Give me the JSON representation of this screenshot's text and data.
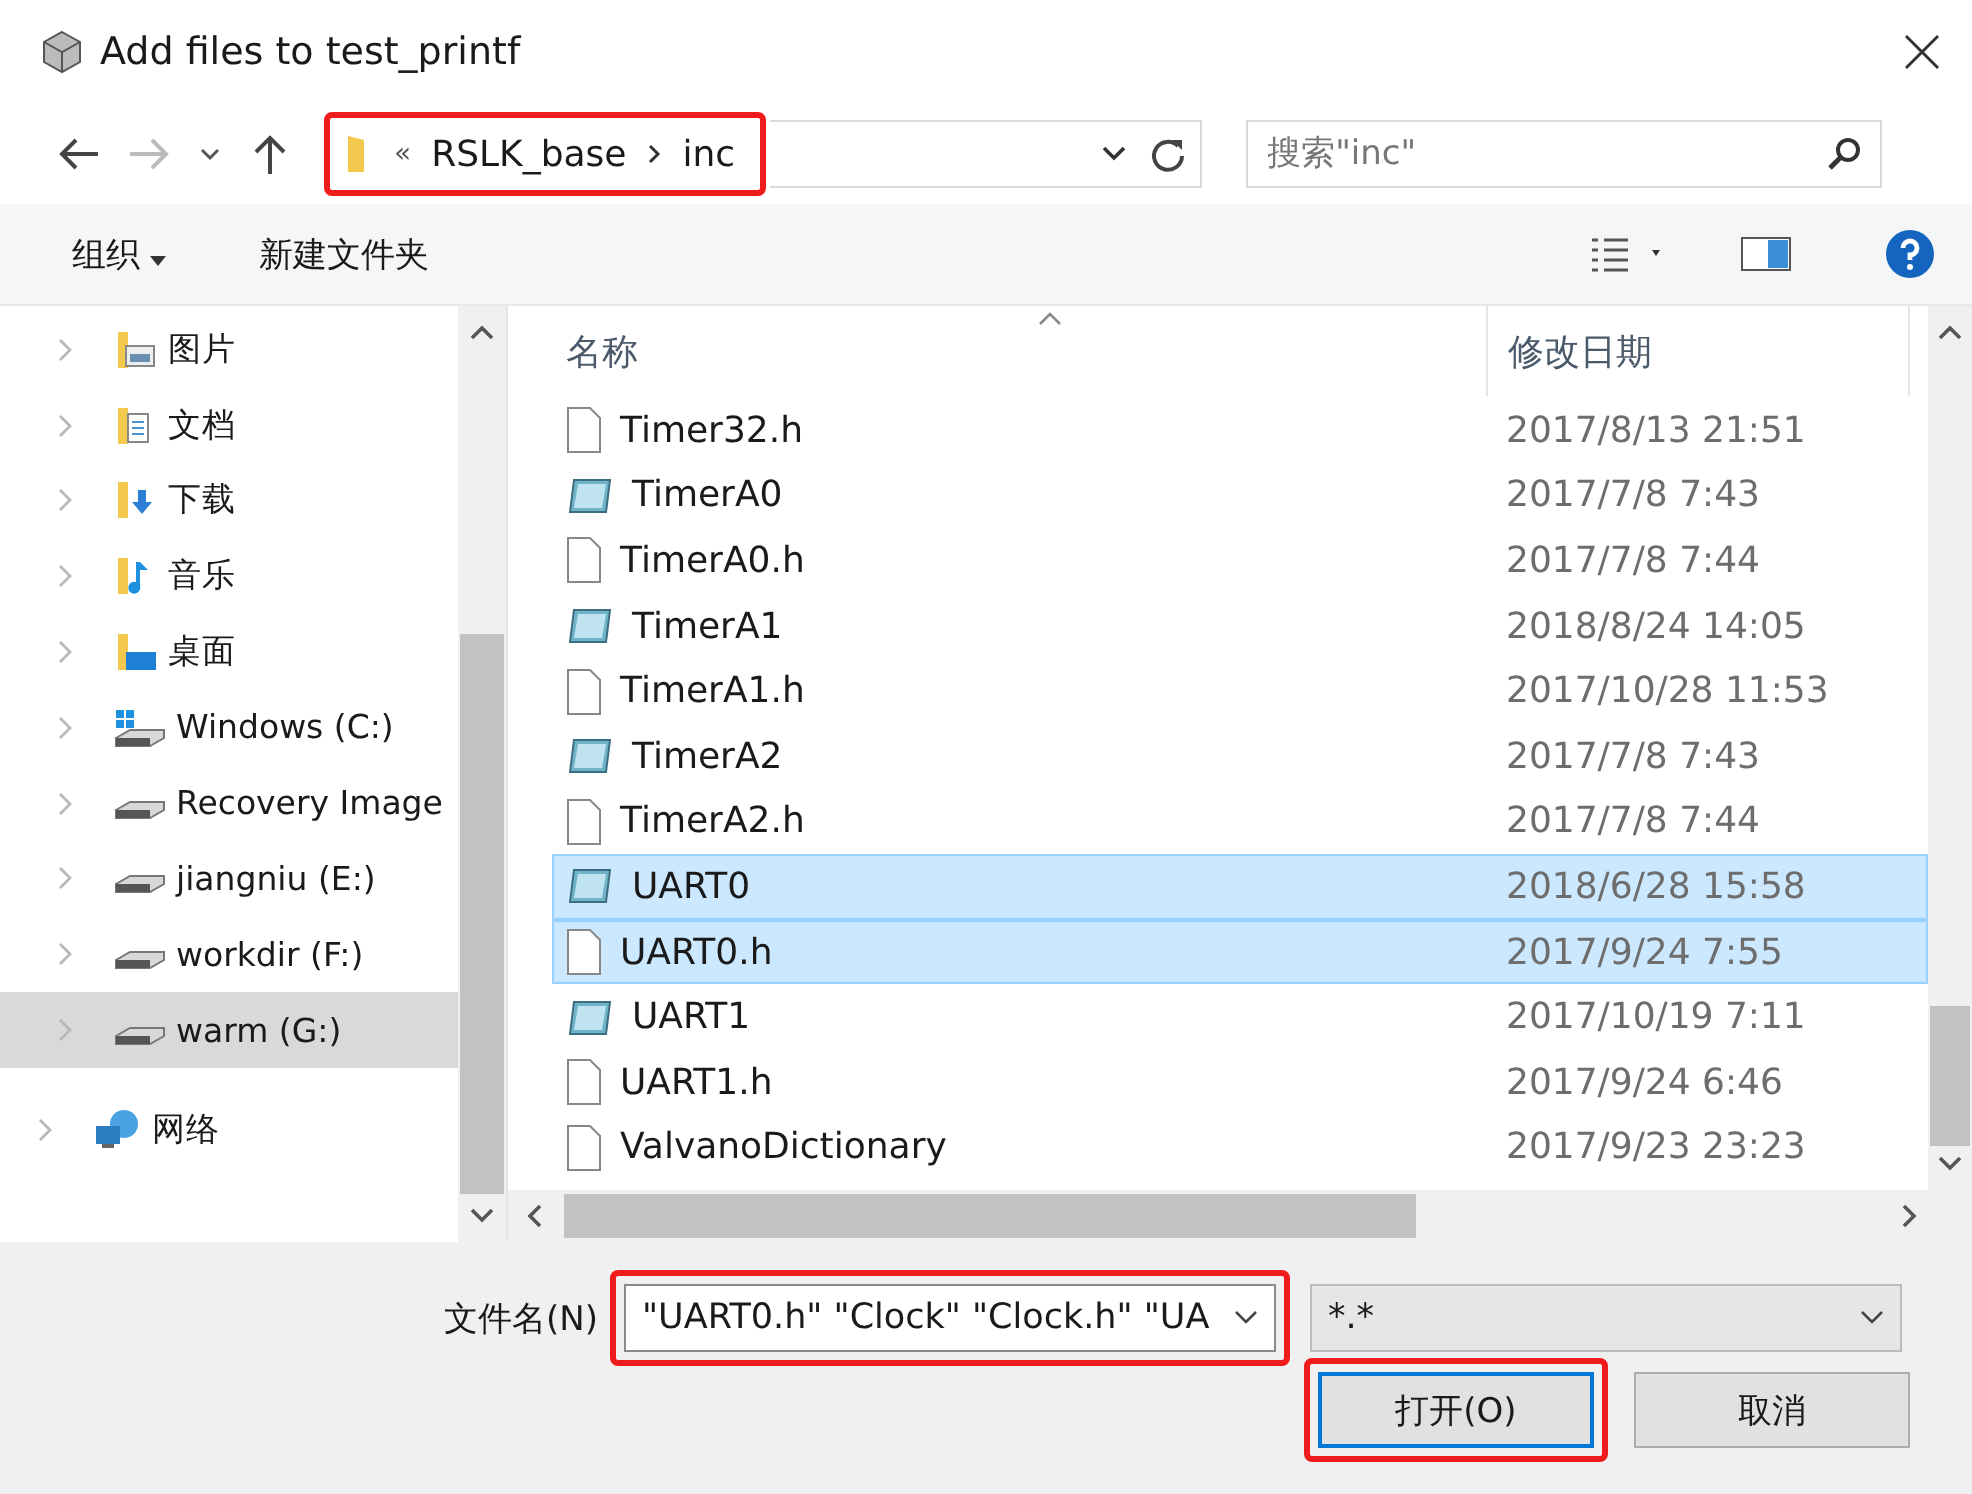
{
  "window": {
    "title": "Add files to test_printf"
  },
  "address": {
    "overflow": "«",
    "path": [
      "RSLK_base",
      "inc"
    ],
    "highlighted": true
  },
  "search": {
    "placeholder": "搜索\"inc\""
  },
  "toolbar": {
    "organize": "组织",
    "new_folder": "新建文件夹"
  },
  "sidebar": {
    "items": [
      {
        "label": "图片",
        "kind": "pictures",
        "selected": false
      },
      {
        "label": "文档",
        "kind": "documents",
        "selected": false
      },
      {
        "label": "下载",
        "kind": "downloads",
        "selected": false
      },
      {
        "label": "音乐",
        "kind": "music",
        "selected": false
      },
      {
        "label": "桌面",
        "kind": "desktop",
        "selected": false
      },
      {
        "label": "Windows (C:)",
        "kind": "system-drive",
        "selected": false
      },
      {
        "label": "Recovery Image",
        "kind": "drive",
        "selected": false
      },
      {
        "label": "jiangniu (E:)",
        "kind": "drive",
        "selected": false
      },
      {
        "label": "workdir (F:)",
        "kind": "drive",
        "selected": false
      },
      {
        "label": "warm (G:)",
        "kind": "drive",
        "selected": true
      },
      {
        "label": "网络",
        "kind": "network",
        "selected": false
      }
    ]
  },
  "table": {
    "columns": [
      "名称",
      "修改日期"
    ],
    "rows": [
      {
        "name": "Timer32.h",
        "date": "2017/8/13 21:51",
        "kind": "file",
        "selected": false
      },
      {
        "name": "TimerA0",
        "date": "2017/7/8 7:43",
        "kind": "program",
        "selected": false
      },
      {
        "name": "TimerA0.h",
        "date": "2017/7/8 7:44",
        "kind": "file",
        "selected": false
      },
      {
        "name": "TimerA1",
        "date": "2018/8/24 14:05",
        "kind": "program",
        "selected": false
      },
      {
        "name": "TimerA1.h",
        "date": "2017/10/28 11:53",
        "kind": "file",
        "selected": false
      },
      {
        "name": "TimerA2",
        "date": "2017/7/8 7:43",
        "kind": "program",
        "selected": false
      },
      {
        "name": "TimerA2.h",
        "date": "2017/7/8 7:44",
        "kind": "file",
        "selected": false
      },
      {
        "name": "UART0",
        "date": "2018/6/28 15:58",
        "kind": "program",
        "selected": true
      },
      {
        "name": "UART0.h",
        "date": "2017/9/24 7:55",
        "kind": "file",
        "selected": true
      },
      {
        "name": "UART1",
        "date": "2017/10/19 7:11",
        "kind": "program",
        "selected": false
      },
      {
        "name": "UART1.h",
        "date": "2017/9/24 6:46",
        "kind": "file",
        "selected": false
      },
      {
        "name": "ValvanoDictionary",
        "date": "2017/9/23 23:23",
        "kind": "file",
        "selected": false
      }
    ]
  },
  "filename": {
    "label": "文件名(N)",
    "value": "\"UART0.h\" \"Clock\" \"Clock.h\" \"UA",
    "highlighted": true
  },
  "filetype": {
    "value": "*.*"
  },
  "buttons": [
    {
      "label": "打开(O)",
      "highlighted": true
    },
    {
      "label": "取消",
      "highlighted": false
    }
  ]
}
